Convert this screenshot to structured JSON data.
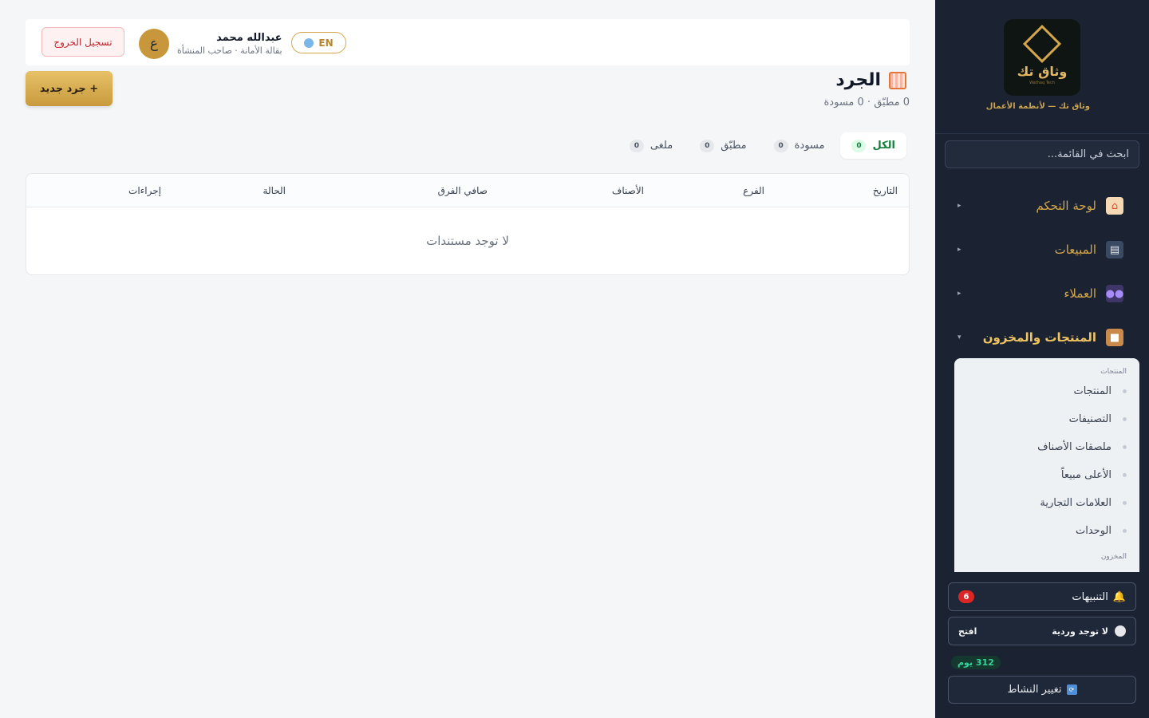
{
  "sidebar": {
    "logo_text": "وثاق تك",
    "logo_sub": "Wathaq Tech",
    "tagline": "وثاق تك — لأنظمة الأعمال",
    "search_placeholder": "ابحث في القائمة...",
    "nav": [
      {
        "label": "لوحة التحكم",
        "icon": "house-icon",
        "arrow": "▸"
      },
      {
        "label": "المبيعات",
        "icon": "cart-icon",
        "arrow": "▸"
      },
      {
        "label": "العملاء",
        "icon": "users-icon",
        "arrow": "▸"
      },
      {
        "label": "المنتجات والمخزون",
        "icon": "box-icon",
        "arrow": "▾",
        "active": true
      }
    ],
    "submenu": {
      "products_heading": "المنتجات",
      "items": [
        "المنتجات",
        "التصنيفات",
        "ملصقات الأصناف",
        "الأعلى مبيعاً",
        "العلامات التجارية",
        "الوحدات"
      ],
      "inventory_heading": "المخزون"
    },
    "alerts": {
      "label": "التنبيهات",
      "count": "6"
    },
    "shift": {
      "label": "لا توجد وردية",
      "open_label": "افتح"
    },
    "days": "312 يوم",
    "switch_label": "تغيير النشاط"
  },
  "topbar": {
    "user_name": "عبدالله محمد",
    "user_role": "بقالة الأمانة · صاحب المنشأة",
    "avatar_letter": "ع",
    "lang_label": "EN",
    "logout_label": "تسجيل الخروج"
  },
  "page": {
    "title": "الجرد",
    "subtitle": "0 مطبّق · 0 مسودة",
    "new_button": "+ جرد جديد",
    "tabs": [
      {
        "label": "الكل",
        "count": "0",
        "active": true
      },
      {
        "label": "مسودة",
        "count": "0"
      },
      {
        "label": "مطبّق",
        "count": "0"
      },
      {
        "label": "ملغى",
        "count": "0"
      }
    ],
    "table": {
      "columns": [
        "التاريخ",
        "الفرع",
        "الأصناف",
        "صافي الفرق",
        "الحالة",
        "إجراءات"
      ],
      "empty_text": "لا توجد مستندات"
    }
  },
  "colors": {
    "accent": "#d4a64a",
    "sidebar_bg": "#1b2333",
    "active_tab": "#15803d",
    "danger": "#c0262d"
  }
}
